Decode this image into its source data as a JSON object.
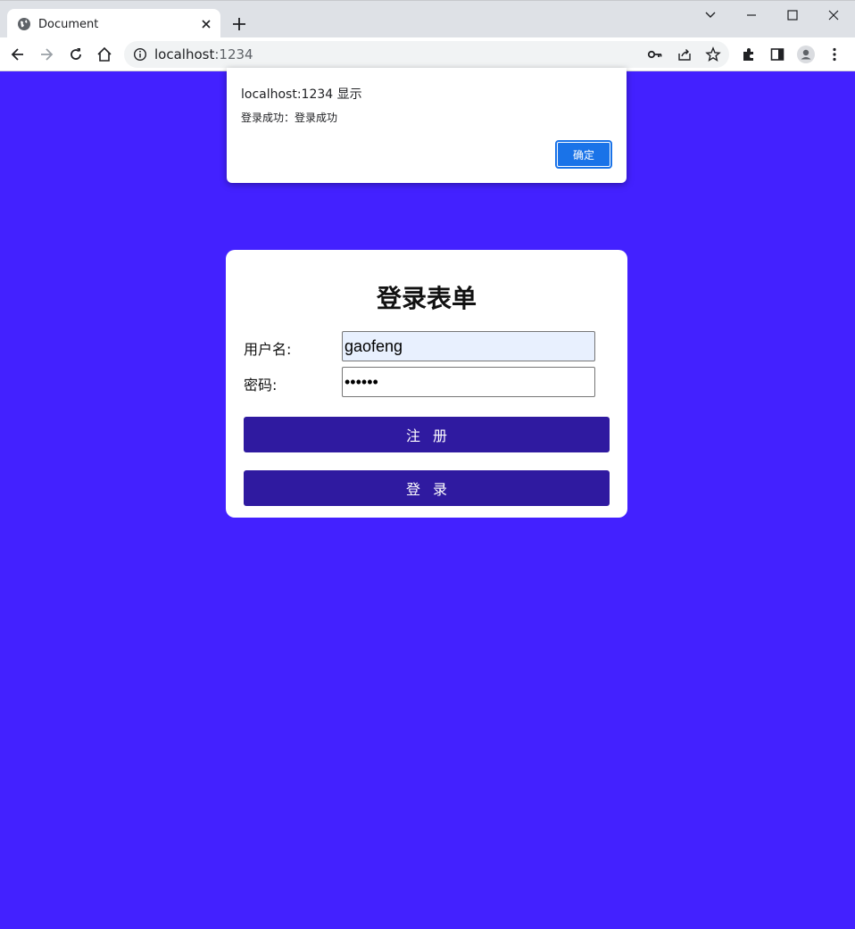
{
  "browser": {
    "tab_title": "Document",
    "url_host": "localhost",
    "url_port": ":1234"
  },
  "alert": {
    "title": "localhost:1234 显示",
    "message": "登录成功：登录成功",
    "ok_label": "确定"
  },
  "form": {
    "title": "登录表单",
    "username_label": "用户名:",
    "username_value": "gaofeng",
    "password_label": "密码:",
    "password_value": "••••••",
    "register_label": "注册",
    "login_label": "登录"
  },
  "colors": {
    "page_background": "#4321ff",
    "button_background": "#2f1aa0",
    "alert_ok": "#1a73e8",
    "autofill": "#e8f0fe"
  }
}
